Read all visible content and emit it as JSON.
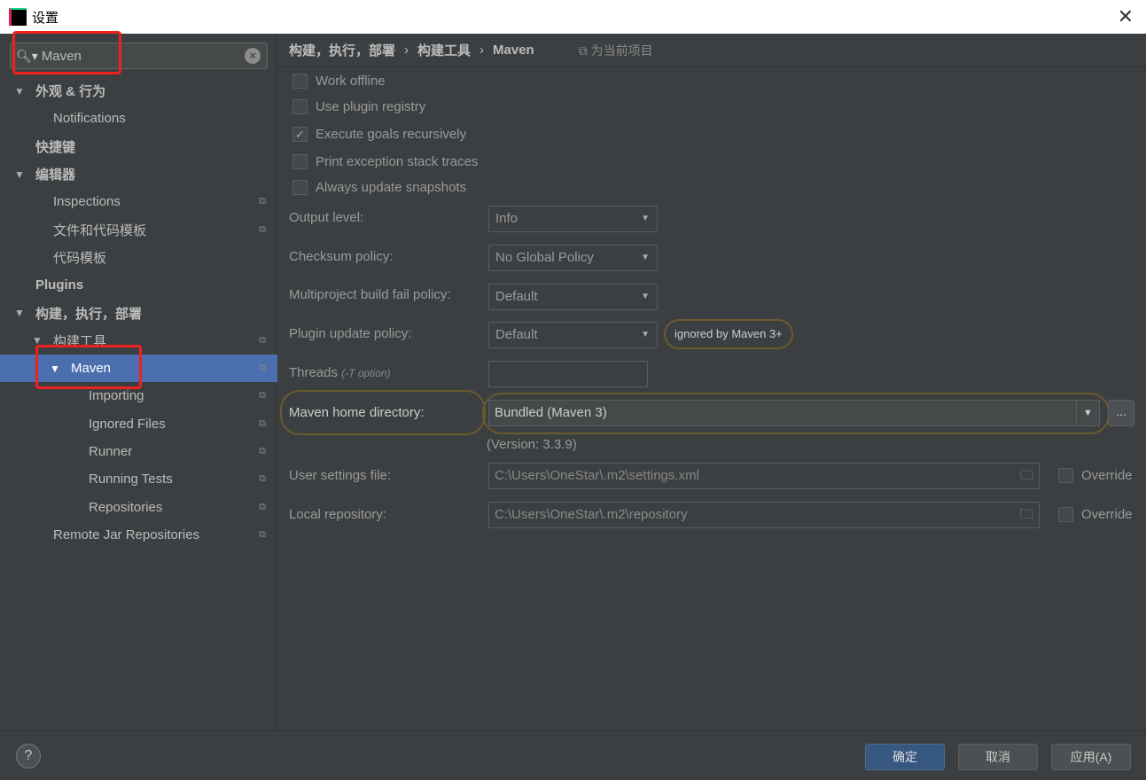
{
  "window": {
    "title": "设置",
    "logo": "IJ",
    "close_icon": "close-icon"
  },
  "search": {
    "value": "Maven"
  },
  "tree": [
    {
      "label": "外观 & 行为",
      "level": 0,
      "bold": true,
      "arrow": "▼"
    },
    {
      "label": "Notifications",
      "level": 1
    },
    {
      "label": "快捷键",
      "level": 0,
      "bold": true
    },
    {
      "label": "编辑器",
      "level": 0,
      "bold": true,
      "arrow": "▼"
    },
    {
      "label": "Inspections",
      "level": 1,
      "copy": true
    },
    {
      "label": "文件和代码模板",
      "level": 1,
      "copy": true
    },
    {
      "label": "代码模板",
      "level": 1
    },
    {
      "label": "Plugins",
      "level": 0,
      "bold": true
    },
    {
      "label": "构建，执行，部署",
      "level": 0,
      "bold": true,
      "arrow": "▼"
    },
    {
      "label": "构建工具",
      "level": 1,
      "arrow": "▼",
      "copy": true
    },
    {
      "label": "Maven",
      "level": 2,
      "arrow": "▼",
      "copy": true,
      "selected": true
    },
    {
      "label": "Importing",
      "level": 3,
      "copy": true
    },
    {
      "label": "Ignored Files",
      "level": 3,
      "copy": true
    },
    {
      "label": "Runner",
      "level": 3,
      "copy": true
    },
    {
      "label": "Running Tests",
      "level": 3,
      "copy": true
    },
    {
      "label": "Repositories",
      "level": 3,
      "copy": true
    },
    {
      "label": "Remote Jar Repositories",
      "level": 1,
      "copy": true
    }
  ],
  "breadcrumb": {
    "items": [
      "构建，执行，部署",
      "构建工具",
      "Maven"
    ],
    "project_label": "为当前项目"
  },
  "checkboxes": [
    {
      "label": "Work offline",
      "checked": false
    },
    {
      "label": "Use plugin registry",
      "checked": false
    },
    {
      "label": "Execute goals recursively",
      "checked": true
    },
    {
      "label": "Print exception stack traces",
      "checked": false
    },
    {
      "label": "Always update snapshots",
      "checked": false
    }
  ],
  "fields": {
    "output_level": {
      "label": "Output level:",
      "value": "Info"
    },
    "checksum": {
      "label": "Checksum policy:",
      "value": "No Global Policy"
    },
    "multiproject": {
      "label": "Multiproject build fail policy:",
      "value": "Default"
    },
    "plugin_update": {
      "label": "Plugin update policy:",
      "value": "Default",
      "note": "ignored by Maven 3+"
    },
    "threads": {
      "label": "Threads",
      "hint": "(-T option)",
      "value": ""
    },
    "maven_home": {
      "label": "Maven home directory:",
      "value": "Bundled (Maven 3)",
      "version": "(Version: 3.3.9)",
      "browse": "..."
    },
    "user_settings": {
      "label": "User settings file:",
      "value": "C:\\Users\\OneStar\\.m2\\settings.xml",
      "override": "Override"
    },
    "local_repo": {
      "label": "Local repository:",
      "value": "C:\\Users\\OneStar\\.m2\\repository",
      "override": "Override"
    }
  },
  "footer": {
    "help": "?",
    "ok": "确定",
    "cancel": "取消",
    "apply": "应用(A)"
  }
}
